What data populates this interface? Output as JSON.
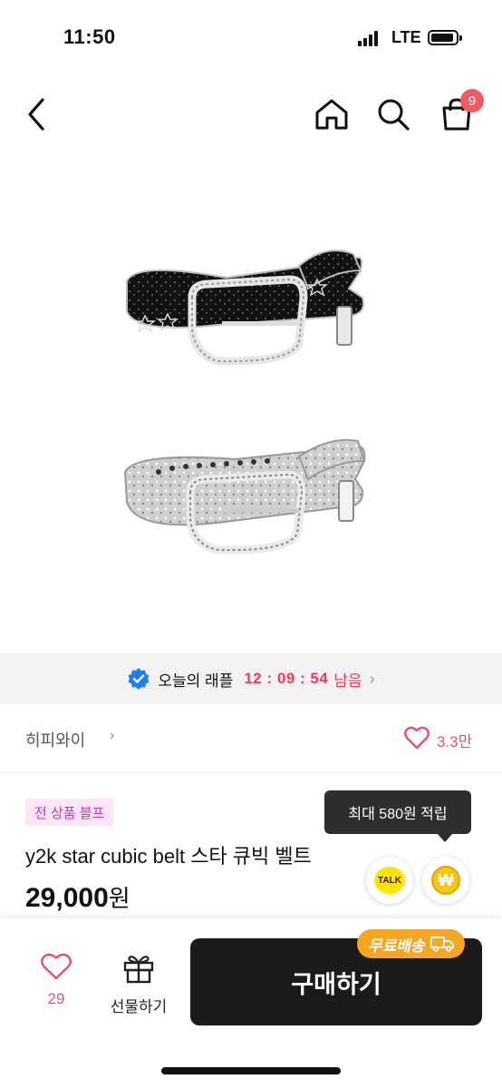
{
  "status": {
    "time": "11:50",
    "network": "LTE"
  },
  "nav": {
    "cart_count": "9"
  },
  "raffle": {
    "label": "오늘의 래플",
    "timer": "12 : 09 : 54",
    "suffix": "남음",
    "chevron": "›"
  },
  "brand": {
    "name": "히피와이",
    "chevron": "›",
    "likes": "3.3만"
  },
  "product": {
    "tag": "전 상품 블프",
    "title": "y2k star cubic belt 스타 큐빅 벨트",
    "price_number": "29,000",
    "price_unit": "원"
  },
  "tooltip": {
    "text": "최대 580원 적립"
  },
  "kakao": {
    "label": "TALK"
  },
  "point": {
    "symbol": "₩"
  },
  "bottom": {
    "wish_count": "29",
    "gift_label": "선물하기",
    "buy_label": "구매하기",
    "free_shipping": "무료배송"
  },
  "colors": {
    "accent_red": "#ee3c5a",
    "badge": "#f05a64",
    "buy_button": "#1a1a1a",
    "free_ship": "#f5a623",
    "kakao": "#fee500"
  }
}
